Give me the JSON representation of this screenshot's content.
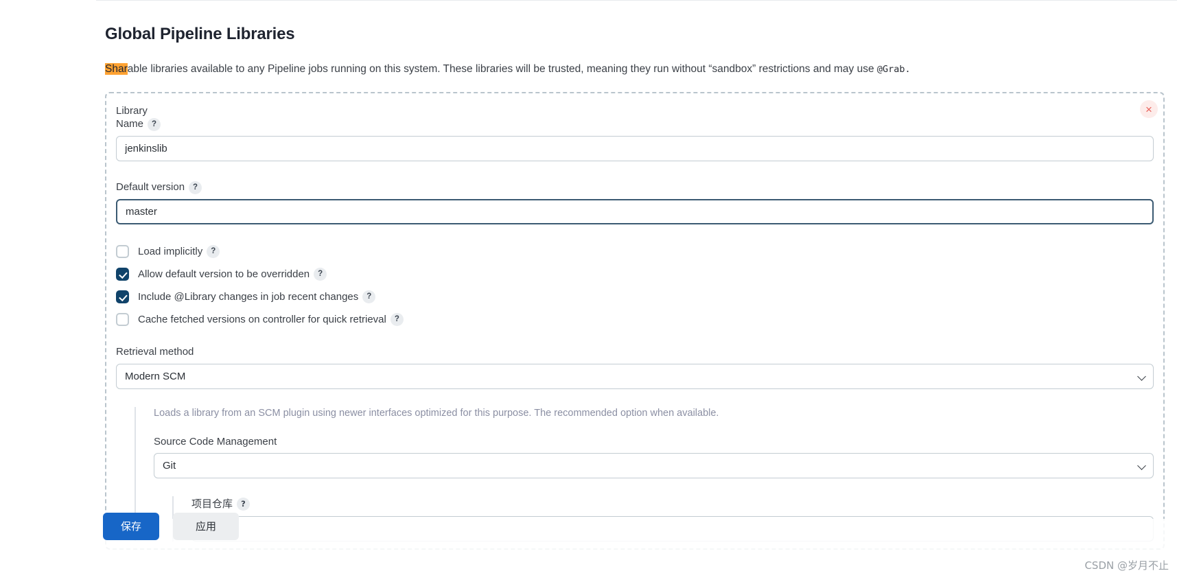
{
  "page": {
    "title": "Global Pipeline Libraries",
    "intro_highlight": "Shar",
    "intro_rest": "able libraries available to any Pipeline jobs running on this system. These libraries will be trusted, meaning they run without “sandbox” restrictions and may use ",
    "intro_code": "@Grab."
  },
  "library": {
    "close_label": "×",
    "name_label_line1": "Library",
    "name_label_line2": "Name",
    "help": "?",
    "name_value": "jenkinslib",
    "default_version_label": "Default version",
    "default_version_value": "master",
    "checkboxes": [
      {
        "label": "Load implicitly",
        "checked": false,
        "help": "?"
      },
      {
        "label": "Allow default version to be overridden",
        "checked": true,
        "help": "?"
      },
      {
        "label": "Include @Library changes in job recent changes",
        "checked": true,
        "help": "?"
      },
      {
        "label": "Cache fetched versions on controller for quick retrieval",
        "checked": false,
        "help": "?"
      }
    ],
    "retrieval_method_label": "Retrieval method",
    "retrieval_method_value": "Modern SCM",
    "scm_description": "Loads a library from an SCM plugin using newer interfaces optimized for this purpose. The recommended option when available.",
    "scm_label": "Source Code Management",
    "scm_value": "Git",
    "repo_label": "项目仓库",
    "repo_help": "?"
  },
  "footer": {
    "save_label": "保存",
    "apply_label": "应用",
    "watermark": "CSDN @岁月不止"
  },
  "colors": {
    "accent_blue": "#1766c7",
    "checkbox_checked": "#10436a",
    "highlight_orange": "#ffa333",
    "close_red": "#e8615a"
  }
}
